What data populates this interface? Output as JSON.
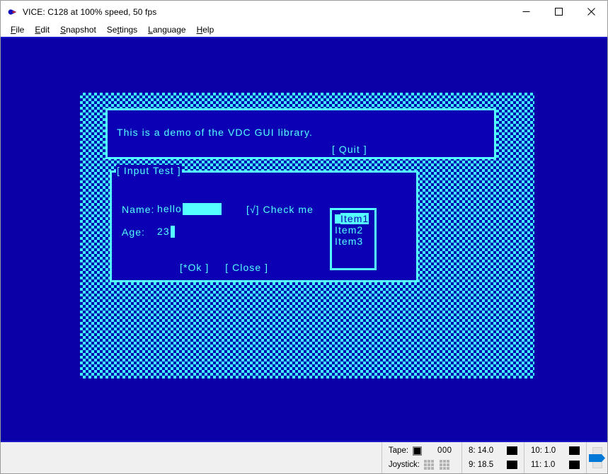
{
  "window": {
    "title": "VICE: C128 at 100% speed, 50 fps",
    "icon": "commodore-logo-icon",
    "controls": {
      "minimize": "minimize-icon",
      "maximize": "maximize-icon",
      "close": "close-icon"
    }
  },
  "menubar": {
    "items": [
      {
        "label": "File",
        "accel": "F"
      },
      {
        "label": "Edit",
        "accel": "E"
      },
      {
        "label": "Snapshot",
        "accel": "S"
      },
      {
        "label": "Settings",
        "accel": "t"
      },
      {
        "label": "Language",
        "accel": "L"
      },
      {
        "label": "Help",
        "accel": "H"
      }
    ]
  },
  "emulator": {
    "message_panel": {
      "text": "This is a demo of the VDC GUI library.",
      "quit_button": "[ Quit ]"
    },
    "input_dialog": {
      "frame_title": "[ Input Test ]",
      "name_label": "Name:",
      "name_value": "hello",
      "age_label": "Age:",
      "age_value": "23",
      "checkbox_label": "[√] Check me",
      "listbox": {
        "items": [
          "Item1",
          "Item2",
          "Item3"
        ],
        "selected_index": 0
      },
      "ok_button": "[*Ok ]",
      "close_button": "[ Close ]"
    },
    "colors": {
      "background": "#0b00a8",
      "screen_dither_fg": "#3ff0ff",
      "screen_dither_bg": "#0000b0",
      "panel_fill": "#0b00b4",
      "foreground": "#55ffff"
    }
  },
  "statusbar": {
    "tape_label": "Tape:",
    "tape_counter": "000",
    "joystick_label": "Joystick:",
    "drives": [
      {
        "label": "8: 14.0"
      },
      {
        "label": "9: 18.5"
      },
      {
        "label": "10: 1.0"
      },
      {
        "label": "11: 1.0"
      }
    ]
  }
}
